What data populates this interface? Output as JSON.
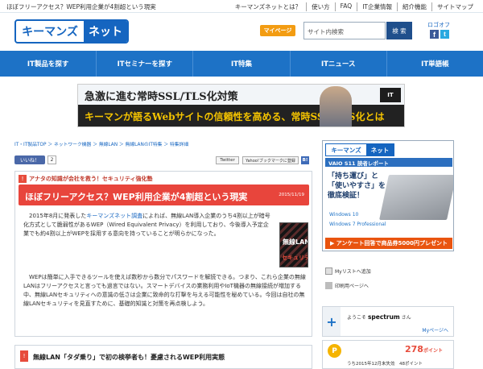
{
  "topbar": {
    "headline": "ほぼフリーアクセス？WEP利用企業が4割超という現実",
    "links": [
      "キーマンズネットとは？",
      "使い方",
      "FAQ",
      "IT企業情報",
      "紹介機能",
      "サイトマップ"
    ]
  },
  "header": {
    "logo_left": "キーマンズ",
    "logo_right": "ネット",
    "mypage_label": "マイページ",
    "search_placeholder": "サイト内検索",
    "search_button": "検 索",
    "logo_off_label": "ロゴオフ",
    "facebook_glyph": "f",
    "twitter_glyph": "t"
  },
  "nav": {
    "items": [
      "IT製品を探す",
      "ITセミナーを探す",
      "IT特集",
      "ITニュース",
      "IT単語帳"
    ]
  },
  "banner": {
    "line1": "急激に進む常時SSL/TLS化対策",
    "line2": "キーマンが語るWebサイトの信頼性を高める、常時SSL/TLS化とは",
    "badge": "IT"
  },
  "breadcrumb": "IT・IT製品TOP ＞ ネットワーク機器 ＞ 無線LAN ＞ 無線LANのIT特集 ＞ 特集詳細",
  "social": {
    "like_label": "いいね！",
    "like_count": "2",
    "tweet_label": "Twitter",
    "yahoo_label": "Yahoo!ブックマークに登録",
    "bl_label": "B!"
  },
  "article": {
    "series_badge": "!",
    "series": "アナタの知識が会社を救う！セキュリティ強化塾",
    "title": "ほぼフリーアクセス？WEP利用企業が4割超という現実",
    "date": "2015/11/19",
    "para1_before": "2015年8月に発表した",
    "para1_link": "キーマンズネット調査",
    "para1_after": "によれば、無線LAN導入企業のうち4割以上が暗号化方式として脆弱性があるWEP（Wired Equivalent Privacy）を利用しており、今後導入予定企業でも約4割以上がWEPを採用する意向を持っていることが明らかになった。",
    "para2": "WEPは簡単に入手できるツールを使えば数秒から数分でパスワードを解読できる。つまり、これら企業の無線LANはフリーアクセスと言っても過言ではない。スマートデバイスの業務利用やIoT機器の無線接続が増加する中、無線LANセキュリティへの意識の低さは企業に致命的な打撃を与える可能性を秘めている。今回は自社の無線LANセキュリティを見直すために、基礎的知識と対策を再点検しよう。",
    "thumb_line1": "無線LAN",
    "thumb_line2": "セキュリティ"
  },
  "related": {
    "icon": "!",
    "title": "無線LAN「タダ乗り」で初の検挙者も！憂慮されるWEP利用実態"
  },
  "sidebar": {
    "ad": {
      "logo_left": "キーマンズ",
      "logo_right": "ネット",
      "vaio_bar": "VAIO S11 読者レポート",
      "headline1": "「持ち運び」と",
      "headline2": "「使いやすさ」を",
      "headline3": "徹底検証！",
      "win1": "Windows 10",
      "win2": "Windows 7 Professional",
      "cta": "▶ アンケート回答で商品券5000円プレゼント"
    },
    "tools": {
      "mylist": "Myリストへ追加",
      "print": "印刷用ページへ"
    },
    "user": {
      "plus": "+",
      "welcome_prefix": "ようこそ",
      "username": "spectrum",
      "welcome_suffix": "さん",
      "mypage_link": "Myページへ"
    },
    "points": {
      "coin": "P",
      "value": "278",
      "unit": "ポイント",
      "expiry": "うち2015年12月末失効　48ポイント"
    }
  },
  "colors": {
    "brand_blue": "#1565c0",
    "nav_blue": "#1d72c6",
    "title_red": "#e8453c",
    "mypage_orange": "#f39c12"
  }
}
